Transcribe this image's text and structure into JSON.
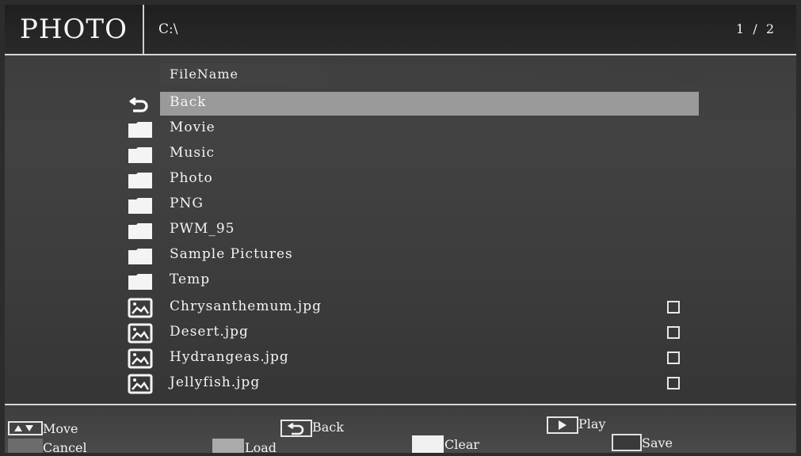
{
  "header": {
    "title": "PHOTO",
    "path": "C:\\",
    "page_current": "1",
    "page_separator": "/",
    "page_total": "2"
  },
  "list": {
    "column_header": "FileName",
    "items": [
      {
        "name": "Back",
        "type": "back",
        "selected": true
      },
      {
        "name": "Movie",
        "type": "folder"
      },
      {
        "name": "Music",
        "type": "folder"
      },
      {
        "name": "Photo",
        "type": "folder"
      },
      {
        "name": "PNG",
        "type": "folder"
      },
      {
        "name": "PWM_95",
        "type": "folder"
      },
      {
        "name": "Sample Pictures",
        "type": "folder"
      },
      {
        "name": "Temp",
        "type": "folder"
      },
      {
        "name": "Chrysanthemum.jpg",
        "type": "image",
        "checked": false
      },
      {
        "name": "Desert.jpg",
        "type": "image",
        "checked": false
      },
      {
        "name": "Hydrangeas.jpg",
        "type": "image",
        "checked": false
      },
      {
        "name": "Jellyfish.jpg",
        "type": "image",
        "checked": false
      }
    ]
  },
  "footer": {
    "move_label": "Move",
    "back_label": "Back",
    "play_label": "Play",
    "cancel_label": "Cancel",
    "load_label": "Load",
    "clear_label": "Clear",
    "save_label": "Save",
    "cancel_key_icon": "red-key-icon",
    "load_key_icon": "green-key-icon",
    "clear_key_icon": "yellow-key-icon",
    "save_key_icon": "blue-key-icon"
  },
  "colors": {
    "selection": "#9a9a9a",
    "text": "#f2f2f2",
    "background": "#3c3c3c"
  }
}
